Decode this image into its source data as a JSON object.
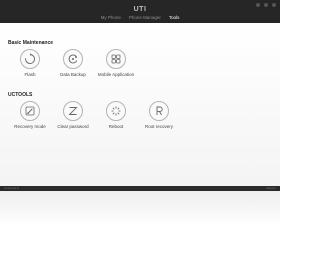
{
  "app": {
    "logo_text": "UTI"
  },
  "nav": {
    "tabs": [
      {
        "label": "My Phone"
      },
      {
        "label": "Phone Manager"
      },
      {
        "label": "Tools"
      }
    ]
  },
  "sections": {
    "basic": {
      "title": "Basic Maintenance",
      "tools": [
        {
          "label": "Flash",
          "icon": "flash-icon"
        },
        {
          "label": "Data Backup",
          "icon": "backup-icon"
        },
        {
          "label": "Mobile Application",
          "icon": "apps-icon"
        }
      ]
    },
    "uctools": {
      "title": "UCTOOLS",
      "tools": [
        {
          "label": "Recovery mode",
          "icon": "recovery-mode-icon"
        },
        {
          "label": "Clear password",
          "icon": "clear-password-icon"
        },
        {
          "label": "Reboot",
          "icon": "reboot-icon"
        },
        {
          "label": "Root recovery",
          "icon": "root-recovery-icon"
        }
      ]
    }
  },
  "status": {
    "left": "Connected",
    "right": "Version"
  }
}
